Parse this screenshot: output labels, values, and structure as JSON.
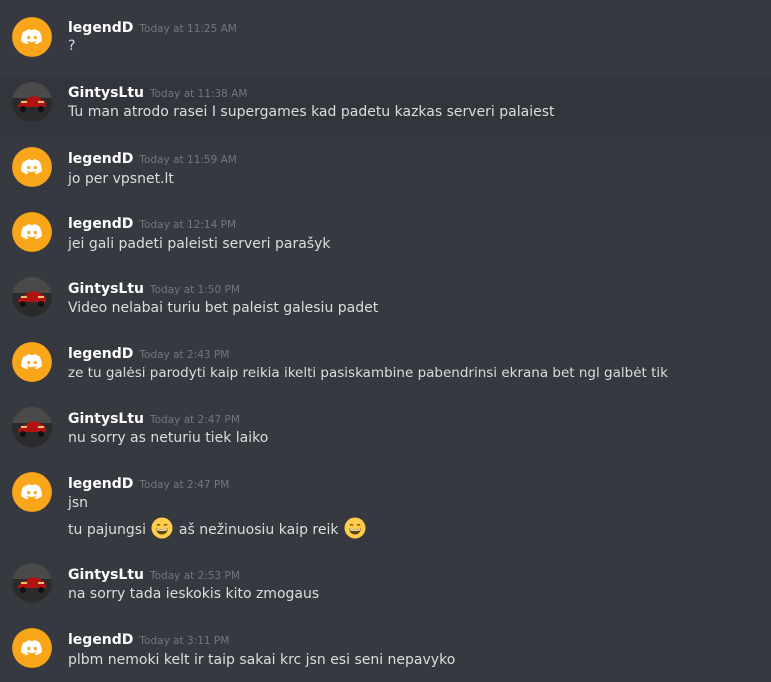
{
  "users": {
    "legendD": "legendD",
    "gintys": "GintysLtu"
  },
  "colors": {
    "background": "#36393f",
    "hover_row": "#32353b",
    "discord_avatar_bg": "#faa61a",
    "author": "#ffffff",
    "timestamp": "#72767d",
    "message_text": "#dcddde"
  },
  "messages": [
    {
      "author": "legendD",
      "avatar": "discord-logo-icon",
      "time": "Today at 11:25 AM",
      "lines": [
        "?"
      ]
    },
    {
      "author": "GintysLtu",
      "avatar": "red-car-icon",
      "time": "Today at 11:38 AM",
      "lines": [
        "Tu man atrodo rasei I supergames kad padetu kazkas serveri palaiest"
      ]
    },
    {
      "author": "legendD",
      "avatar": "discord-logo-icon",
      "time": "Today at 11:59 AM",
      "lines": [
        "jo per vpsnet.lt"
      ]
    },
    {
      "author": "legendD",
      "avatar": "discord-logo-icon",
      "time": "Today at 12:14 PM",
      "lines": [
        "jei gali padeti paleisti serveri parašyk"
      ]
    },
    {
      "author": "GintysLtu",
      "avatar": "red-car-icon",
      "time": "Today at 1:50 PM",
      "lines": [
        "Video nelabai turiu bet paleist galesiu padet"
      ]
    },
    {
      "author": "legendD",
      "avatar": "discord-logo-icon",
      "time": "Today at 2:43 PM",
      "lines": [
        "ze tu galėsi parodyti kaip reikia ikelti pasiskambine pabendrinsi ekrana bet ngl galbėt tik"
      ]
    },
    {
      "author": "GintysLtu",
      "avatar": "red-car-icon",
      "time": "Today at 2:47 PM",
      "lines": [
        "nu sorry as neturiu tiek laiko"
      ]
    },
    {
      "author": "legendD",
      "avatar": "discord-logo-icon",
      "time": "Today at 2:47 PM",
      "lines": [
        "jsn"
      ],
      "line2_parts": [
        "tu pajungsi",
        "aš nežinuosiu kaip reik"
      ],
      "emoji": "grinning-smile-emoji"
    },
    {
      "author": "GintysLtu",
      "avatar": "red-car-icon",
      "time": "Today at 2:53 PM",
      "lines": [
        "na sorry tada ieskokis kito zmogaus"
      ]
    },
    {
      "author": "legendD",
      "avatar": "discord-logo-icon",
      "time": "Today at 3:11 PM",
      "lines": [
        "plbm nemoki kelt ir taip sakai krc jsn esi seni nepavyko"
      ]
    }
  ]
}
